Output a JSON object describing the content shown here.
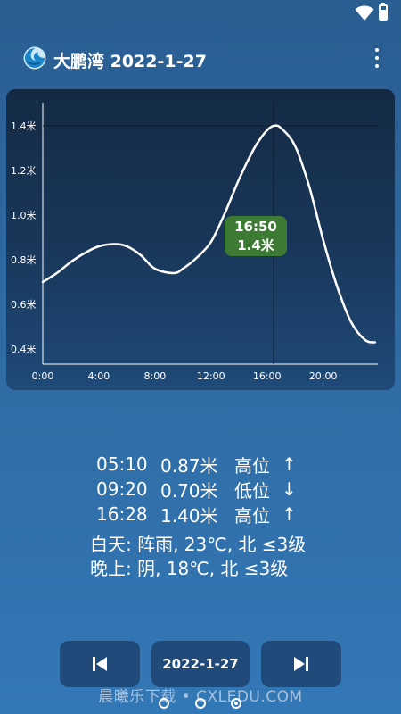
{
  "status_bar": {
    "battery_level": 0.7,
    "icons": [
      "wifi-icon",
      "battery-icon"
    ]
  },
  "app_bar": {
    "title": "大鹏湾 2022-1-27",
    "logo_icon": "wave-logo-icon",
    "menu_icon": "more-vert-icon"
  },
  "chart_data": {
    "type": "line",
    "title": "",
    "xlabel": "",
    "ylabel": "",
    "x_ticks": [
      "0:00",
      "4:00",
      "8:00",
      "12:00",
      "16:00",
      "20:00"
    ],
    "y_ticks": [
      "0.4米",
      "0.6米",
      "0.8米",
      "1.0米",
      "1.2米",
      "1.4米"
    ],
    "xlim": [
      0,
      24
    ],
    "ylim": [
      0.4,
      1.4
    ],
    "grid": false,
    "series": [
      {
        "x": [
          0,
          1,
          2,
          3,
          4,
          5.17,
          6,
          7,
          8,
          9.33,
          10,
          11,
          12,
          13,
          14,
          15,
          15.5,
          16,
          16.47,
          17,
          18,
          19,
          20,
          21,
          22,
          23,
          23.7
        ],
        "values": [
          0.7,
          0.74,
          0.79,
          0.83,
          0.86,
          0.87,
          0.86,
          0.82,
          0.76,
          0.74,
          0.76,
          0.81,
          0.88,
          1.01,
          1.16,
          1.29,
          1.34,
          1.38,
          1.4,
          1.39,
          1.31,
          1.13,
          0.89,
          0.68,
          0.52,
          0.44,
          0.43
        ]
      }
    ],
    "crosshair": {
      "x": 16.47,
      "y": 1.4
    },
    "tooltip": {
      "time": "16:50",
      "height": "1.4米"
    }
  },
  "tides": [
    {
      "time": "05:10",
      "height": "0.87米",
      "type": "高位",
      "arrow": "↑"
    },
    {
      "time": "09:20",
      "height": "0.70米",
      "type": "低位",
      "arrow": "↓"
    },
    {
      "time": "16:28",
      "height": "1.40米",
      "type": "高位",
      "arrow": "↑"
    }
  ],
  "weather": {
    "day": "白天: 阵雨, 23℃, 北 ≤3级",
    "night": "晚上: 阴, 18℃, 北 ≤3级"
  },
  "controls": {
    "date_label": "2022-1-27",
    "prev_icon": "skip-previous-icon",
    "next_icon": "skip-next-icon"
  },
  "watermark": "晨曦乐下载 • CXLEDU.COM",
  "pager": {
    "count": 3,
    "active": 2
  },
  "colors": {
    "curve": "#ffffff",
    "tooltip": "#3d7a34",
    "card_top": "#142a44",
    "button": "#1f4a7a"
  }
}
